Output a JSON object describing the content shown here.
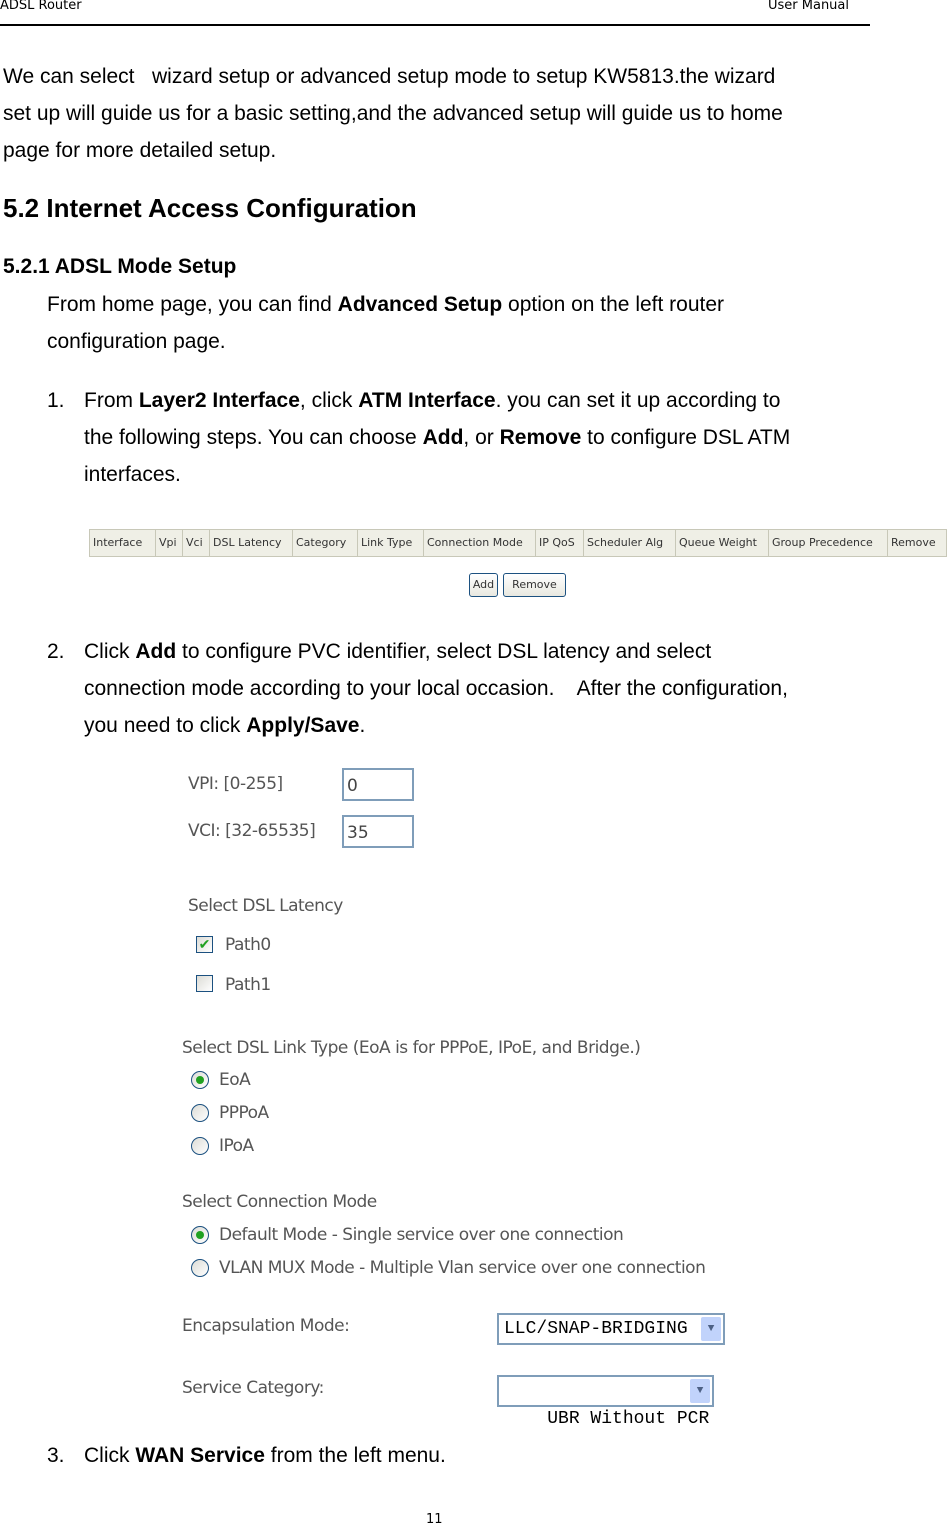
{
  "header": {
    "left": "ADSL Router",
    "right": "User Manual"
  },
  "intro": [
    "We can select   wizard setup or advanced setup mode to setup KW5813.the wizard",
    "set up will guide us for a basic setting,and the advanced setup will guide us to home",
    "page for more detailed setup."
  ],
  "section_title": "5.2 Internet Access Configuration",
  "subsection_title": "5.2.1 ADSL Mode Setup",
  "para": {
    "a": "From home page, you can find ",
    "b": "Advanced Setup",
    "c": " option on the left router",
    "d": "configuration page."
  },
  "step1": {
    "num": "1.",
    "a": "From ",
    "b": "Layer2 Interface",
    "c": ", click ",
    "d": "ATM Interface",
    "e": ". you can set it up according to",
    "f": "the following steps. You can choose ",
    "g": "Add",
    "h": ", or ",
    "i": "Remove",
    "j": " to configure DSL ATM",
    "k": "interfaces."
  },
  "table": {
    "columns": [
      "Interface",
      "Vpi",
      "Vci",
      "DSL Latency",
      "Category",
      "Link Type",
      "Connection Mode",
      "IP QoS",
      "Scheduler Alg",
      "Queue Weight",
      "Group Precedence",
      "Remove"
    ]
  },
  "buttons": {
    "add": "Add",
    "remove": "Remove"
  },
  "step2": {
    "num": "2.",
    "a": "Click ",
    "b": "Add",
    "c": " to configure PVC identifier, select DSL latency and select",
    "d": "connection mode according to your local occasion.    After the configuration,",
    "e": "you need to click ",
    "f": "Apply/Save",
    "g": "."
  },
  "form": {
    "vpi_label": "VPI: [0-255]",
    "vpi_value": "0",
    "vci_label": "VCI: [32-65535]",
    "vci_value": "35",
    "latency_title": "Select DSL Latency",
    "latency": [
      {
        "label": "Path0",
        "checked": true
      },
      {
        "label": "Path1",
        "checked": false
      }
    ],
    "link_title": "Select DSL Link Type (EoA is for PPPoE, IPoE, and Bridge.)",
    "link": [
      {
        "label": "EoA",
        "selected": true
      },
      {
        "label": "PPPoA",
        "selected": false
      },
      {
        "label": "IPoA",
        "selected": false
      }
    ],
    "mode_title": "Select Connection Mode",
    "mode": [
      {
        "label": "Default Mode - Single service over one connection",
        "selected": true
      },
      {
        "label": "VLAN MUX Mode - Multiple Vlan service over one connection",
        "selected": false
      }
    ],
    "encap_label": "Encapsulation Mode:",
    "encap_value": "LLC/SNAP-BRIDGING",
    "service_label": "Service Category:",
    "service_value": "UBR Without PCR"
  },
  "step3": {
    "num": "3.",
    "a": "Click ",
    "b": "WAN Service",
    "c": " from the left menu."
  },
  "page_number": "11",
  "colors": {
    "check": "#21a121",
    "input_border": "#7f9db9"
  }
}
